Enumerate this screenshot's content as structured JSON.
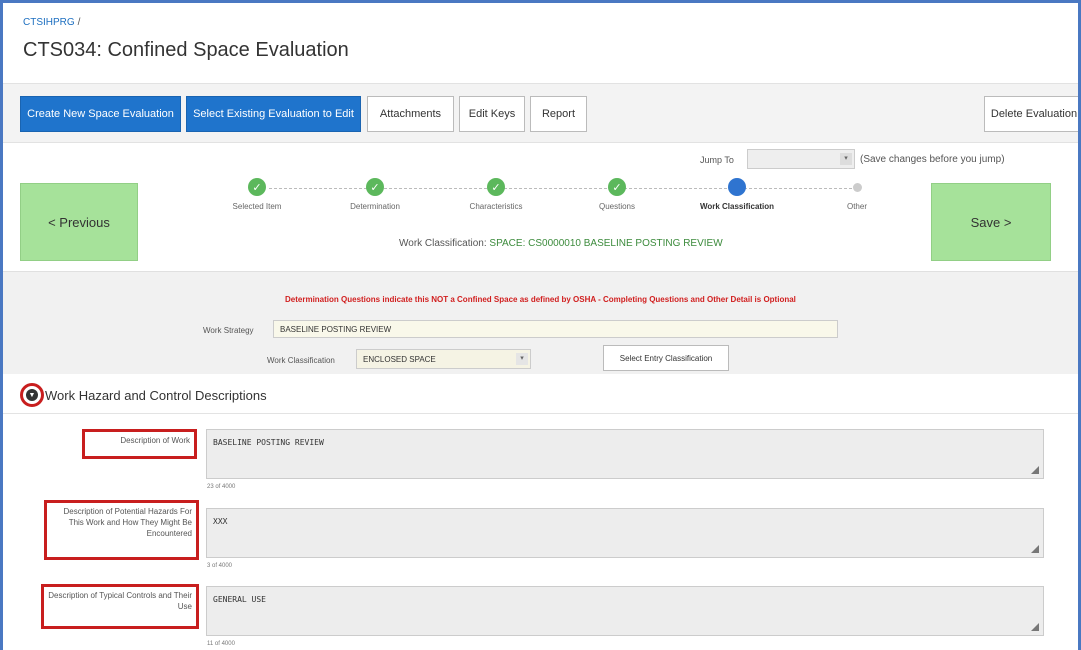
{
  "breadcrumb": {
    "app": "CTSIHPRG",
    "separator": "/"
  },
  "page_title": "CTS034: Confined Space Evaluation",
  "toolbar": {
    "create_new": "Create New Space Evaluation",
    "select_existing": "Select Existing Evaluation to Edit",
    "attachments": "Attachments",
    "edit_keys": "Edit Keys",
    "report": "Report",
    "delete": "Delete Evaluation"
  },
  "wizard": {
    "jump_label": "Jump To",
    "jump_value": "",
    "jump_note": "(Save changes before you jump)",
    "previous": "< Previous",
    "save": "Save >",
    "steps": [
      {
        "label": "Selected Item",
        "state": "done"
      },
      {
        "label": "Determination",
        "state": "done"
      },
      {
        "label": "Characteristics",
        "state": "done"
      },
      {
        "label": "Questions",
        "state": "done"
      },
      {
        "label": "Work Classification",
        "state": "current"
      },
      {
        "label": "Other",
        "state": "future"
      }
    ],
    "wc_prefix": "Work Classification:",
    "wc_value": "SPACE: CS0000010 BASELINE POSTING REVIEW"
  },
  "details": {
    "warning": "Determination Questions indicate this NOT a Confined Space as defined by OSHA - Completing Questions and Other Detail is Optional",
    "work_strategy_label": "Work Strategy",
    "work_strategy_value": "BASELINE POSTING REVIEW",
    "work_classification_label": "Work Classification",
    "work_classification_value": "ENCLOSED SPACE",
    "select_entry_button": "Select Entry Classification"
  },
  "section": {
    "title": "Work Hazard and Control Descriptions"
  },
  "fields": [
    {
      "label": "Description of Work",
      "value": "BASELINE POSTING REVIEW",
      "counter": "23 of 4000"
    },
    {
      "label": "Description of Potential Hazards For This Work and How They Might Be Encountered",
      "value": "XXX",
      "counter": "3 of 4000"
    },
    {
      "label": "Description of Typical Controls and Their Use",
      "value": "GENERAL USE",
      "counter": "11 of 4000"
    }
  ],
  "colors": {
    "primary_button": "#1f74cc",
    "nav_green": "#a6e29a",
    "step_done": "#5cb85c",
    "step_current": "#2f74d0",
    "warning_red": "#d11f1f",
    "highlight_red": "#c81e1e"
  }
}
